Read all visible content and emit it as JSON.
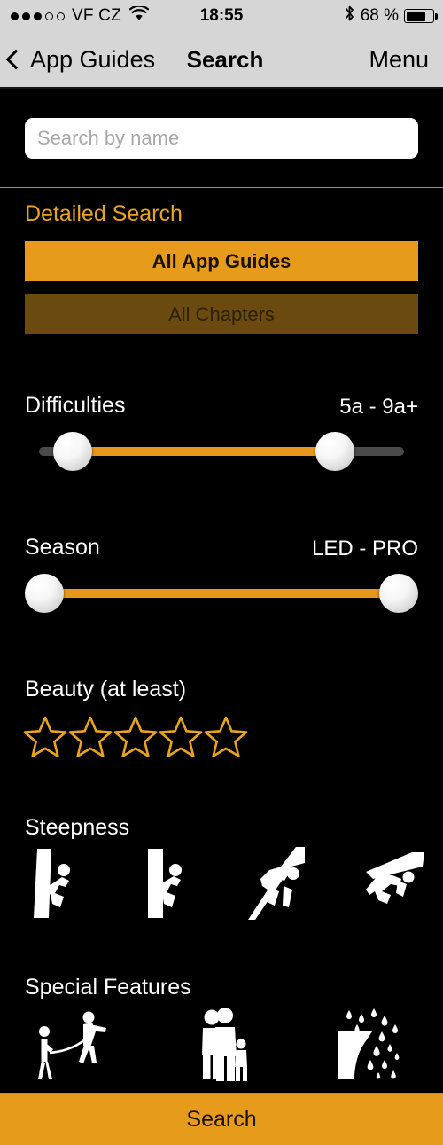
{
  "status_bar": {
    "signal_dots_filled": 3,
    "signal_dots_total": 5,
    "carrier": "VF CZ",
    "wifi_icon": "wifi-icon",
    "time": "18:55",
    "bluetooth_icon": "bluetooth-icon",
    "battery_percent": "68 %",
    "battery_level": 68
  },
  "nav_bar": {
    "back_icon": "chevron-left-icon",
    "back_label": "App Guides",
    "title": "Search",
    "menu_label": "Menu"
  },
  "search": {
    "placeholder": "Search by name",
    "value": ""
  },
  "detailed_search": {
    "heading": "Detailed Search",
    "guides_button": "All App Guides",
    "chapters_button": "All Chapters"
  },
  "difficulties": {
    "label": "Difficulties",
    "value": "5a - 9a+",
    "min_label": "5a",
    "max_label": "9a+",
    "low_percent": 8,
    "high_percent": 82
  },
  "season": {
    "label": "Season",
    "value": "LED - PRO",
    "min_label": "LED",
    "max_label": "PRO",
    "low_percent": 0,
    "high_percent": 100
  },
  "beauty": {
    "label": "Beauty (at least)",
    "stars_total": 5,
    "stars_selected": 0,
    "star_icon": "star-outline-icon"
  },
  "steepness": {
    "label": "Steepness",
    "options": [
      {
        "icon": "slab-climber-icon",
        "selected": false
      },
      {
        "icon": "vertical-climber-icon",
        "selected": false
      },
      {
        "icon": "overhang-climber-icon",
        "selected": false
      },
      {
        "icon": "roof-climber-icon",
        "selected": false
      }
    ]
  },
  "special_features": {
    "label": "Special Features",
    "options": [
      {
        "icon": "belay-partner-icon",
        "selected": false
      },
      {
        "icon": "family-friendly-icon",
        "selected": false
      },
      {
        "icon": "rain-protected-icon",
        "selected": false
      }
    ]
  },
  "footer": {
    "search_button": "Search"
  },
  "colors": {
    "background": "#000000",
    "accent_orange": "#e79b1b",
    "accent_dim": "#6b4a10",
    "heading_orange": "#e8a41e",
    "slider_track": "#4a4a4a",
    "bar_gray": "#d6d6d6",
    "text_white": "#ffffff"
  }
}
